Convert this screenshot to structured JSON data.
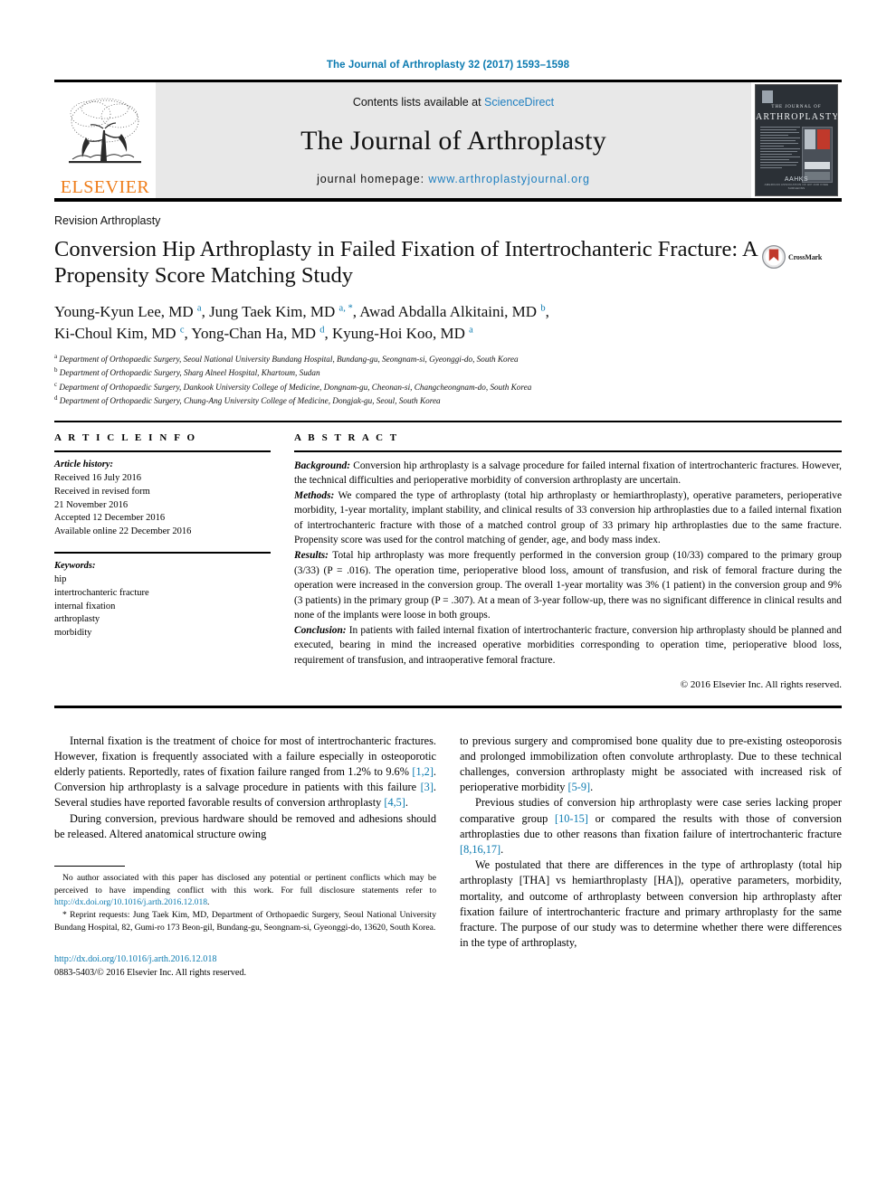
{
  "running_head": "The Journal of Arthroplasty 32 (2017) 1593–1598",
  "masthead": {
    "contents_prefix": "Contents lists available at ",
    "contents_link": "ScienceDirect",
    "journal_name": "The Journal of Arthroplasty",
    "homepage_prefix": "journal homepage: ",
    "homepage_url": "www.arthroplastyjournal.org",
    "publisher": "ELSEVIER",
    "cover": {
      "line1": "THE JOURNAL OF",
      "line2": "ARTHROPLASTY",
      "society": "AAHKS",
      "society_sub": "AMERICAN ASSOCIATION OF HIP AND KNEE SURGEONS"
    }
  },
  "article": {
    "section": "Revision Arthroplasty",
    "title": "Conversion Hip Arthroplasty in Failed Fixation of Intertrochanteric Fracture: A Propensity Score Matching Study",
    "crossmark_label": "CrossMark",
    "authors_line_1": "Young-Kyun Lee, MD a, Jung Taek Kim, MD a, *, Awad Abdalla Alkitaini, MD b,",
    "authors_line_2": "Ki-Choul Kim, MD c, Yong-Chan Ha, MD d, Kyung-Hoi Koo, MD a",
    "authors": [
      {
        "name": "Young-Kyun Lee, MD",
        "marks": "a",
        "sep": ", "
      },
      {
        "name": "Jung Taek Kim, MD",
        "marks": "a, *",
        "sep": ", "
      },
      {
        "name": "Awad Abdalla Alkitaini, MD",
        "marks": "b",
        "sep": ","
      },
      {
        "name": "Ki-Choul Kim, MD",
        "marks": "c",
        "sep": ", "
      },
      {
        "name": "Yong-Chan Ha, MD",
        "marks": "d",
        "sep": ", "
      },
      {
        "name": "Kyung-Hoi Koo, MD",
        "marks": "a",
        "sep": ""
      }
    ],
    "affiliations": [
      {
        "mark": "a",
        "text": "Department of Orthopaedic Surgery, Seoul National University Bundang Hospital, Bundang-gu, Seongnam-si, Gyeonggi-do, South Korea"
      },
      {
        "mark": "b",
        "text": "Department of Orthopaedic Surgery, Sharg Alneel Hospital, Khartoum, Sudan"
      },
      {
        "mark": "c",
        "text": "Department of Orthopaedic Surgery, Dankook University College of Medicine, Dongnam-gu, Cheonan-si, Changcheongnam-do, South Korea"
      },
      {
        "mark": "d",
        "text": "Department of Orthopaedic Surgery, Chung-Ang University College of Medicine, Dongjak-gu, Seoul, South Korea"
      }
    ]
  },
  "article_info": {
    "heading": "A R T I C L E   I N F O",
    "history_label": "Article history:",
    "history": [
      "Received 16 July 2016",
      "Received in revised form",
      "21 November 2016",
      "Accepted 12 December 2016",
      "Available online 22 December 2016"
    ],
    "keywords_label": "Keywords:",
    "keywords": [
      "hip",
      "intertrochanteric fracture",
      "internal fixation",
      "arthroplasty",
      "morbidity"
    ]
  },
  "abstract": {
    "heading": "A B S T R A C T",
    "background_label": "Background:",
    "background_text": " Conversion hip arthroplasty is a salvage procedure for failed internal fixation of intertrochanteric fractures. However, the technical difficulties and perioperative morbidity of conversion arthroplasty are uncertain.",
    "methods_label": "Methods:",
    "methods_text": " We compared the type of arthroplasty (total hip arthroplasty or hemiarthroplasty), operative parameters, perioperative morbidity, 1-year mortality, implant stability, and clinical results of 33 conversion hip arthroplasties due to a failed internal fixation of intertrochanteric fracture with those of a matched control group of 33 primary hip arthroplasties due to the same fracture. Propensity score was used for the control matching of gender, age, and body mass index.",
    "results_label": "Results:",
    "results_text": " Total hip arthroplasty was more frequently performed in the conversion group (10/33) compared to the primary group (3/33) (P = .016). The operation time, perioperative blood loss, amount of transfusion, and risk of femoral fracture during the operation were increased in the conversion group. The overall 1-year mortality was 3% (1 patient) in the conversion group and 9% (3 patients) in the primary group (P = .307). At a mean of 3-year follow-up, there was no significant difference in clinical results and none of the implants were loose in both groups.",
    "conclusion_label": "Conclusion:",
    "conclusion_text": " In patients with failed internal fixation of intertrochanteric fracture, conversion hip arthroplasty should be planned and executed, bearing in mind the increased operative morbidities corresponding to operation time, perioperative blood loss, requirement of transfusion, and intraoperative femoral fracture.",
    "copyright": "© 2016 Elsevier Inc. All rights reserved."
  },
  "body": {
    "left": {
      "p1_a": "Internal fixation is the treatment of choice for most of intertrochanteric fractures. However, fixation is frequently associated with a failure especially in osteoporotic elderly patients. Reportedly, rates of fixation failure ranged from 1.2% to 9.6% ",
      "p1_ref1": "[1,2]",
      "p1_b": ". Conversion hip arthroplasty is a salvage procedure in patients with this failure ",
      "p1_ref2": "[3]",
      "p1_c": ". Several studies have reported favorable results of conversion arthroplasty ",
      "p1_ref3": "[4,5]",
      "p1_d": ".",
      "p2": "During conversion, previous hardware should be removed and adhesions should be released. Altered anatomical structure owing"
    },
    "right": {
      "p1_a": "to previous surgery and compromised bone quality due to pre-existing osteoporosis and prolonged immobilization often convolute arthroplasty. Due to these technical challenges, conversion arthroplasty might be associated with increased risk of perioperative morbidity ",
      "p1_ref": "[5-9]",
      "p1_b": ".",
      "p2_a": "Previous studies of conversion hip arthroplasty were case series lacking proper comparative group ",
      "p2_ref1": "[10-15]",
      "p2_b": " or compared the results with those of conversion arthroplasties due to other reasons than fixation failure of intertrochanteric fracture ",
      "p2_ref2": "[8,16,17]",
      "p2_c": ".",
      "p3": "We postulated that there are differences in the type of arthroplasty (total hip arthroplasty [THA] vs hemiarthroplasty [HA]), operative parameters, morbidity, mortality, and outcome of arthroplasty between conversion hip arthroplasty after fixation failure of intertrochanteric fracture and primary arthroplasty for the same fracture. The purpose of our study was to determine whether there were differences in the type of arthroplasty,"
    }
  },
  "footnotes": {
    "disclosure_a": "No author associated with this paper has disclosed any potential or pertinent conflicts which may be perceived to have impending conflict with this work. For full disclosure statements refer to ",
    "disclosure_link": "http://dx.doi.org/10.1016/j.arth.2016.12.018",
    "disclosure_b": ".",
    "reprint": "* Reprint requests: Jung Taek Kim, MD, Department of Orthopaedic Surgery, Seoul National University Bundang Hospital, 82, Gumi-ro 173 Beon-gil, Bundang-gu, Seongnam-si, Gyeonggi-do, 13620, South Korea.",
    "doi": "http://dx.doi.org/10.1016/j.arth.2016.12.018",
    "issn_line": "0883-5403/© 2016 Elsevier Inc. All rights reserved."
  },
  "colors": {
    "link": "#0a7ab0",
    "elsevier_orange": "#ef7d1a",
    "masthead_gray": "#e8e8e8"
  }
}
